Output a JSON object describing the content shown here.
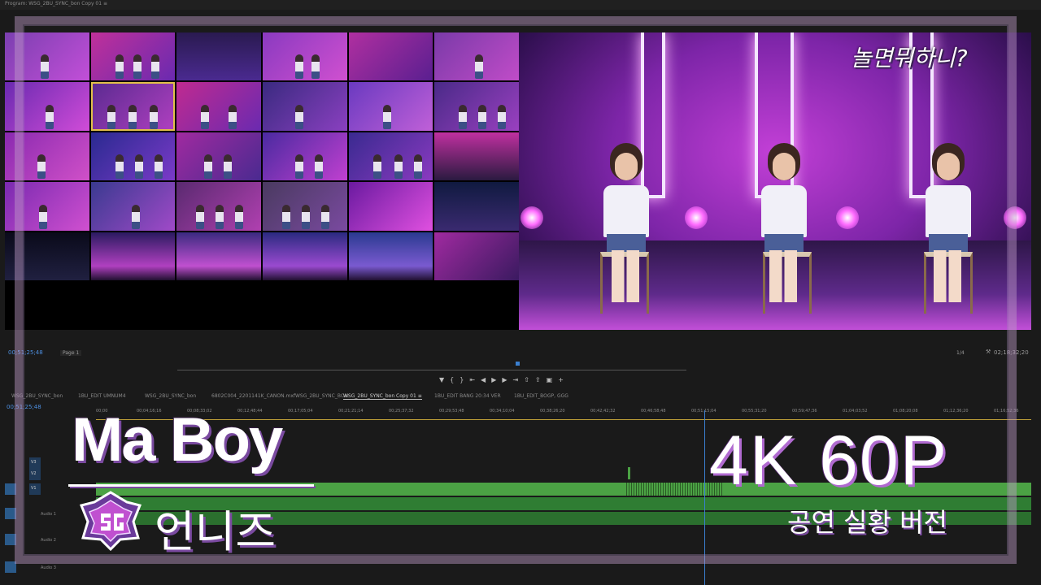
{
  "app": {
    "program_title": "Program: WSG_2BU_SYNC_bon Copy 01 ≡"
  },
  "program_monitor": {
    "broadcast_logo": "놀면뭐하니?",
    "timecode_current": "00;51;25;48",
    "page_select": "Page 1",
    "zoom_fraction": "1/4",
    "timecode_duration": "02;18;32;20"
  },
  "transport": {
    "buttons": [
      "mark-in",
      "mark-out",
      "go-to-in",
      "step-back",
      "play",
      "step-forward",
      "go-to-out",
      "lift",
      "extract",
      "export-frame",
      "add"
    ]
  },
  "timeline": {
    "tabs": [
      "WSG_2BU_SYNC_bon",
      "1BU_EDIT UMNUM4",
      "WSG_2BU_SYNC_bon",
      "6802C004_2201141K_CANON.mxfWSG_2BU_SYNC_BON",
      "WSG_2BU_SYNC_bon Copy 01 ≡",
      "1BU_EDIT BANG 20:34 VER",
      "1BU_EDIT_BOGP, GGG"
    ],
    "active_tab_index": 4,
    "timecode": "00;51;25;48",
    "ruler_ticks": [
      "00;00",
      "00;04;16;16",
      "00;08;33;02",
      "00;12;48;44",
      "00;17;05;04",
      "00;21;21;14",
      "00;25;37;32",
      "00;29;53;48",
      "00;34;10;04",
      "00;38;26;20",
      "00;42;42;32",
      "00;46;58;48",
      "00;51;15;04",
      "00;55;31;20",
      "00;59;47;36",
      "01;04;03;52",
      "01;08;20;08",
      "01;12;36;20",
      "01;16;52;36"
    ],
    "tracks": [
      {
        "id": "V3",
        "label": "V3"
      },
      {
        "id": "V2",
        "label": "V2"
      },
      {
        "id": "V1",
        "label": "V1"
      },
      {
        "id": "A1",
        "label": "Audio 1"
      },
      {
        "id": "A2",
        "label": "Audio 2"
      },
      {
        "id": "A3",
        "label": "Audio 3"
      }
    ]
  },
  "overlay": {
    "song_title": "Ma Boy",
    "artist": "언니즈",
    "spec": "4K 60P",
    "spec_sub": "공연 실황 버전"
  },
  "colors": {
    "accent_purple": "#7a4aa0",
    "clip_green": "#4ba244",
    "timecode_blue": "#4d8fe0",
    "selection_gold": "#e2c04a"
  }
}
